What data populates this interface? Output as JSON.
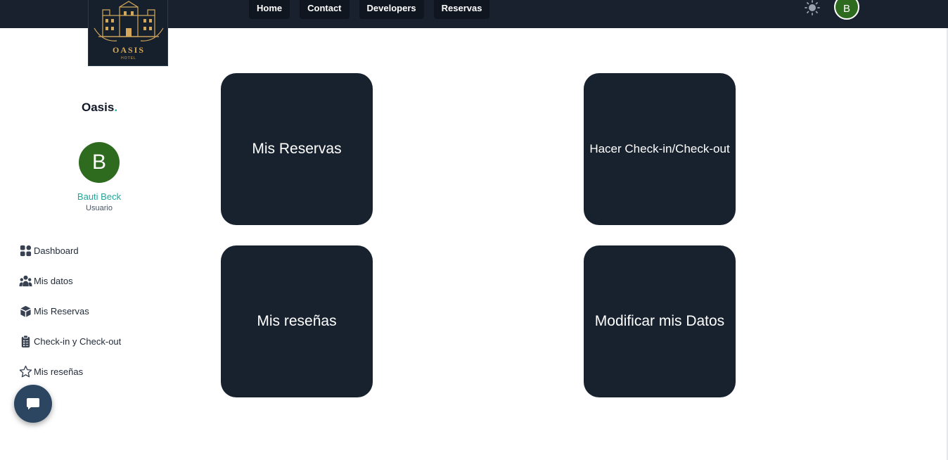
{
  "nav": [
    "Home",
    "Contact",
    "Developers",
    "Reservas"
  ],
  "user_initial": "B",
  "sidebar": {
    "brand": "Oasis",
    "brand_dot": ".",
    "user_name": "Bauti Beck",
    "user_role": "Usuario",
    "items": [
      {
        "label": "Dashboard",
        "icon": "dashboard-icon"
      },
      {
        "label": "Mis datos",
        "icon": "users-icon"
      },
      {
        "label": "Mis Reservas",
        "icon": "box-icon"
      },
      {
        "label": "Check-in y Check-out",
        "icon": "clipboard-icon"
      },
      {
        "label": "Mis reseñas",
        "icon": "star-icon"
      }
    ]
  },
  "cards": [
    "Mis Reservas",
    "Hacer Check-in/Check-out",
    "Mis reseñas",
    "Modificar mis Datos"
  ],
  "logo": {
    "name": "OASIS",
    "sub": "HOTEL"
  },
  "colors": {
    "navbar": "#18212d",
    "card": "#18222f",
    "accent": "#1fb5a8",
    "avatar": "#2e6b1e",
    "chat": "#2c4662"
  }
}
